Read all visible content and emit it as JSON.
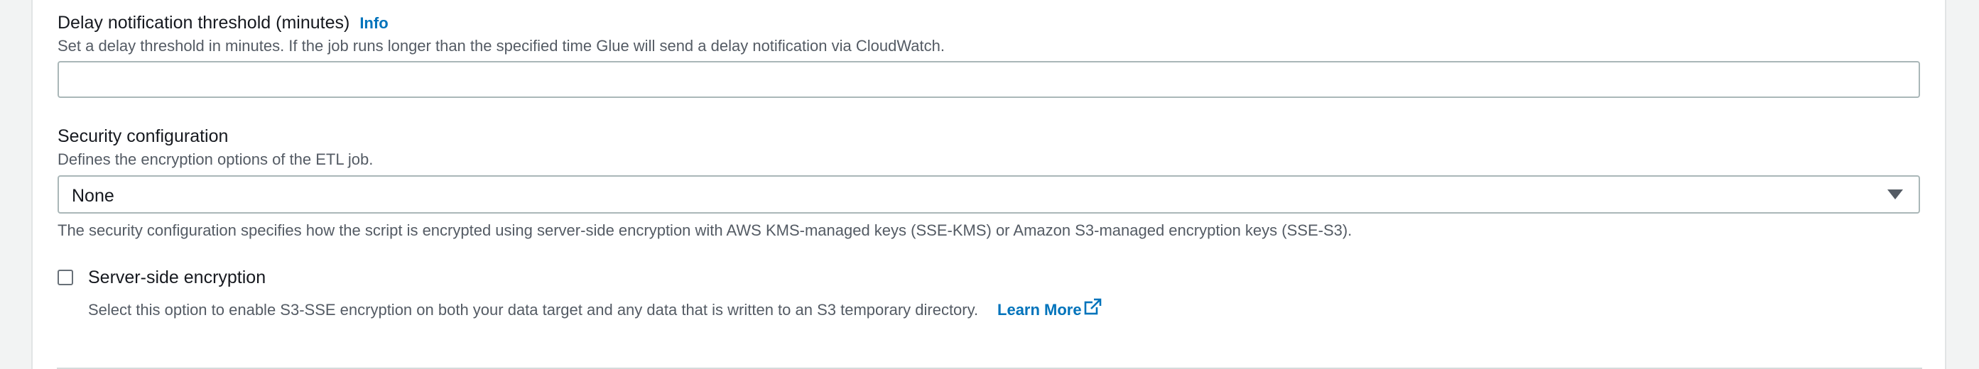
{
  "delay": {
    "label": "Delay notification threshold (minutes)",
    "info": "Info",
    "description": "Set a delay threshold in minutes. If the job runs longer than the specified time Glue will send a delay notification via CloudWatch.",
    "value": ""
  },
  "security": {
    "label": "Security configuration",
    "description": "Defines the encryption options of the ETL job.",
    "selected": "None",
    "help": "The security configuration specifies how the script is encrypted using server-side encryption with AWS KMS-managed keys (SSE-KMS) or Amazon S3-managed encryption keys (SSE-S3)."
  },
  "sse": {
    "label": "Server-side encryption",
    "checked": false,
    "description": "Select this option to enable S3-SSE encryption on both your data target and any data that is written to an S3 temporary directory.",
    "learn_more": "Learn More"
  },
  "colors": {
    "link": "#0073bb",
    "text": "#16191f",
    "muted": "#545b64",
    "border": "#aab7b8"
  },
  "icons": [
    "caret-down-icon",
    "external-link-icon"
  ]
}
